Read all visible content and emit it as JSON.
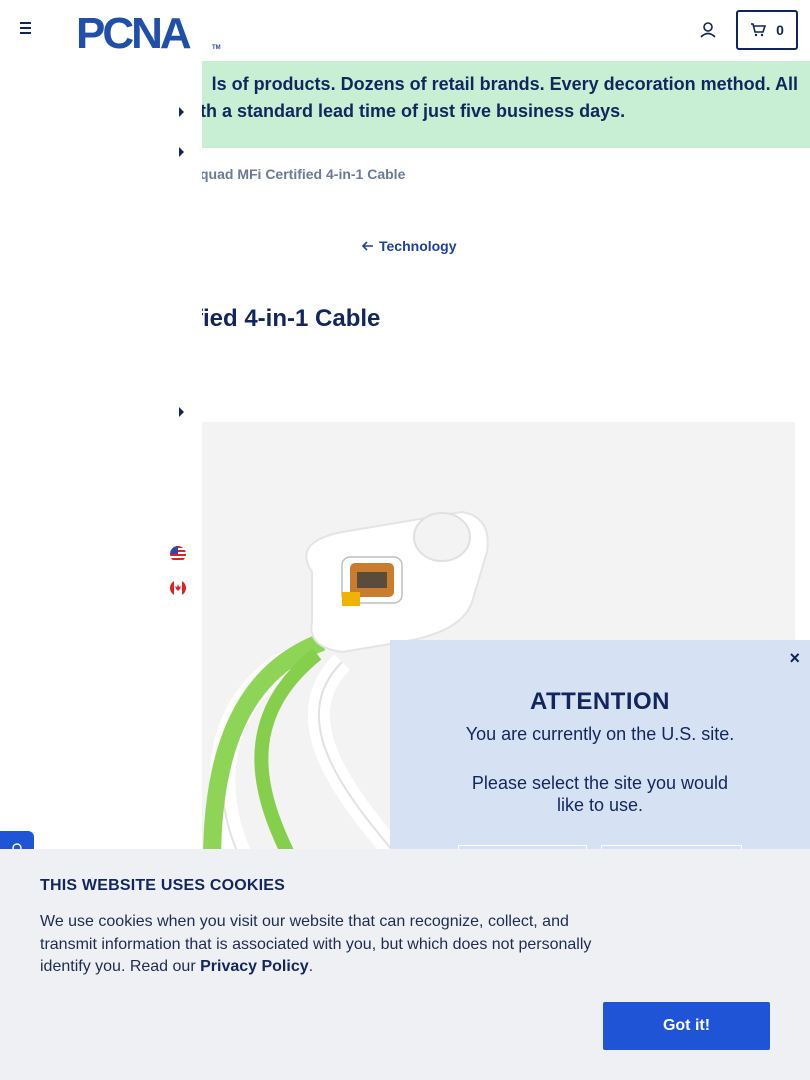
{
  "header": {
    "logo_text": "PCNA",
    "logo_tm": "TM",
    "cart_count": "0"
  },
  "banner": {
    "line1": "ls of products. Dozens of retail brands. Every decoration method. All",
    "line2": "th a standard lead time of just five business days."
  },
  "breadcrumb": {
    "current": "quad MFi Certified 4-in-1 Cable"
  },
  "back_link": {
    "label": "Technology"
  },
  "product": {
    "title": "fied 4-in-1 Cable"
  },
  "attention_modal": {
    "title": "ATTENTION",
    "line1": "You are currently on the U.S. site.",
    "line2": "Please select the site you would like to use.",
    "close": "×"
  },
  "cookie_banner": {
    "title": "THIS WEBSITE USES COOKIES",
    "text_before": "We use cookies when you visit our website that can recognize, collect, and transmit information that is associated with you, but which does not personally identify you. Read our ",
    "link": "Privacy Policy",
    "text_after": ".",
    "button": "Got it!"
  },
  "colors": {
    "brand_navy": "#12265d",
    "accent_blue": "#1f54d6",
    "banner_green": "#c8efd3",
    "modal_bg": "#d6e2f3",
    "cable_green": "#8ed457"
  }
}
